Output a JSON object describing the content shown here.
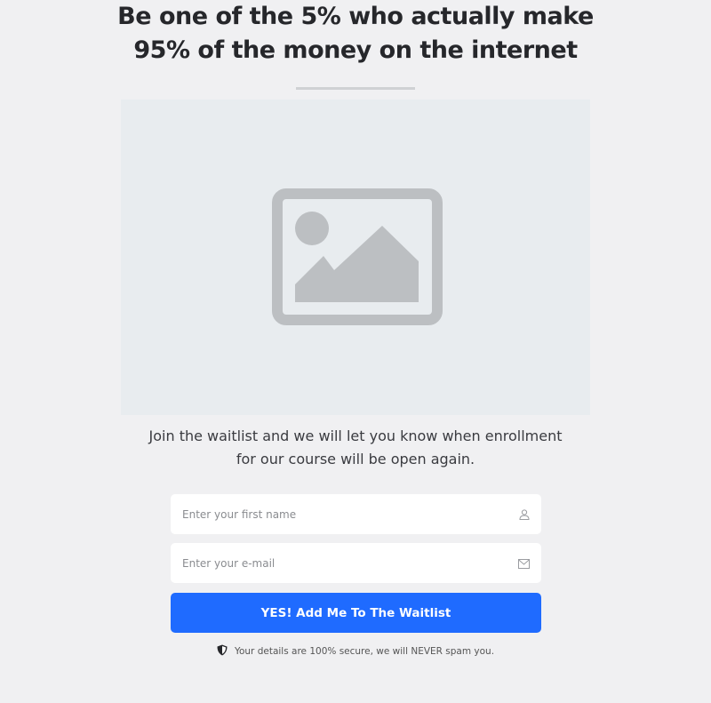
{
  "headline": {
    "line1": "Be one of the 5% who actually make",
    "line2": "95% of the money on the internet"
  },
  "hero_image": {
    "icon": "image-placeholder-icon"
  },
  "intro": {
    "line1": "Join the waitlist and we will let you know when enrollment",
    "line2": "for our course will be open again."
  },
  "form": {
    "first_name": {
      "placeholder": "Enter your first name",
      "value": "",
      "icon": "user-icon"
    },
    "email": {
      "placeholder": "Enter your e-mail",
      "value": "",
      "icon": "envelope-icon"
    },
    "submit_label": "YES! Add Me To The Waitlist"
  },
  "security_note": {
    "icon": "shield-icon",
    "text": "Your details are 100% secure, we will NEVER spam you."
  },
  "colors": {
    "background": "#f0f0f2",
    "accent": "#1f6bff",
    "heading": "#26272b",
    "placeholder_bg": "#e8ecef",
    "placeholder_icon": "#bcbfc2"
  }
}
